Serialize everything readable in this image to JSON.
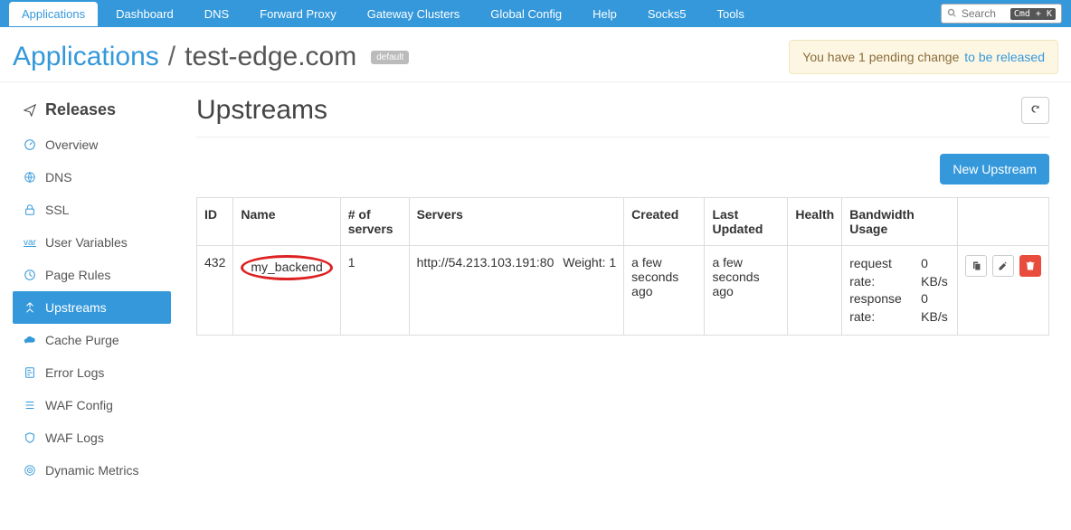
{
  "topTabs": {
    "applications": "Applications",
    "dashboard": "Dashboard",
    "dns": "DNS",
    "forwardProxy": "Forward Proxy",
    "gatewayClusters": "Gateway Clusters",
    "globalConfig": "Global Config",
    "help": "Help",
    "socks5": "Socks5",
    "tools": "Tools"
  },
  "search": {
    "placeholder": "Search",
    "kbd": "Cmd + K"
  },
  "breadcrumb": {
    "root": "Applications",
    "sep": "/",
    "current": "test-edge.com",
    "badge": "default"
  },
  "alert": {
    "text": "You have 1 pending change",
    "link": "to be released"
  },
  "sidebar": {
    "releases": "Releases",
    "overview": "Overview",
    "dns": "DNS",
    "ssl": "SSL",
    "userVariables": "User Variables",
    "pageRules": "Page Rules",
    "upstreams": "Upstreams",
    "cachePurge": "Cache Purge",
    "errorLogs": "Error Logs",
    "wafConfig": "WAF Config",
    "wafLogs": "WAF Logs",
    "dynamicMetrics": "Dynamic Metrics"
  },
  "content": {
    "title": "Upstreams",
    "newBtn": "New Upstream",
    "headers": {
      "id": "ID",
      "name": "Name",
      "numServers": "# of servers",
      "servers": "Servers",
      "created": "Created",
      "lastUpdated": "Last Updated",
      "health": "Health",
      "bandwidth": "Bandwidth Usage"
    },
    "row": {
      "id": "432",
      "name": "my_backend",
      "numServers": "1",
      "serverUrl": "http://54.213.103.191:80",
      "serverWeight": "Weight: 1",
      "created": "a few seconds ago",
      "lastUpdated": "a few seconds ago",
      "health": "",
      "bwReqLabel": "request rate:",
      "bwRespLabel": "response rate:",
      "bwReqVal": "0 KB/s",
      "bwRespVal": "0 KB/s"
    }
  }
}
